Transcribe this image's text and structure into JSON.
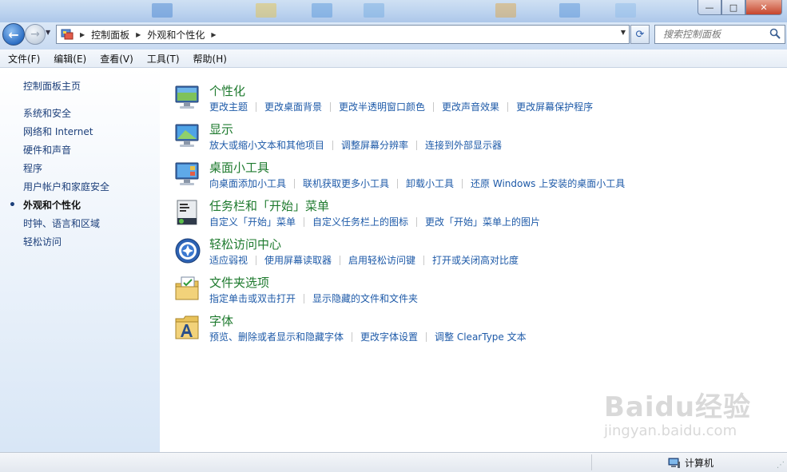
{
  "window": {
    "controls": {
      "minimize": "—",
      "maximize": "□",
      "close": "✕"
    }
  },
  "navigation": {
    "back_icon": "←",
    "forward_icon": "→",
    "breadcrumb": [
      "控制面板",
      "外观和个性化"
    ],
    "refresh_icon": "⟳",
    "search_placeholder": "搜索控制面板"
  },
  "menubar": [
    "文件(F)",
    "编辑(E)",
    "查看(V)",
    "工具(T)",
    "帮助(H)"
  ],
  "sidebar": {
    "home": "控制面板主页",
    "items": [
      "系统和安全",
      "网络和 Internet",
      "硬件和声音",
      "程序",
      "用户帐户和家庭安全",
      "外观和个性化",
      "时钟、语言和区域",
      "轻松访问"
    ],
    "current_index": 5
  },
  "categories": [
    {
      "title": "个性化",
      "icon": "personalization-monitor-icon",
      "links": [
        "更改主题",
        "更改桌面背景",
        "更改半透明窗口颜色",
        "更改声音效果",
        "更改屏幕保护程序"
      ]
    },
    {
      "title": "显示",
      "icon": "display-monitor-icon",
      "links": [
        "放大或缩小文本和其他项目",
        "调整屏幕分辨率",
        "连接到外部显示器"
      ]
    },
    {
      "title": "桌面小工具",
      "icon": "desktop-gadgets-icon",
      "links": [
        "向桌面添加小工具",
        "联机获取更多小工具",
        "卸载小工具",
        "还原 Windows 上安装的桌面小工具"
      ]
    },
    {
      "title": "任务栏和「开始」菜单",
      "icon": "taskbar-icon",
      "links": [
        "自定义「开始」菜单",
        "自定义任务栏上的图标",
        "更改「开始」菜单上的图片"
      ]
    },
    {
      "title": "轻松访问中心",
      "icon": "ease-of-access-icon",
      "links": [
        "适应弱视",
        "使用屏幕读取器",
        "启用轻松访问键",
        "打开或关闭高对比度"
      ]
    },
    {
      "title": "文件夹选项",
      "icon": "folder-options-icon",
      "links": [
        "指定单击或双击打开",
        "显示隐藏的文件和文件夹"
      ]
    },
    {
      "title": "字体",
      "icon": "fonts-folder-icon",
      "links": [
        "预览、删除或者显示和隐藏字体",
        "更改字体设置",
        "调整 ClearType 文本"
      ]
    }
  ],
  "statusbar": {
    "computer_label": "计算机"
  },
  "watermark": {
    "main": "Baidu经验",
    "sub": "jingyan.baidu.com"
  },
  "colors": {
    "category_title": "#1e7a2e",
    "link": "#1e5aa8",
    "nav_text": "#1c3f7a"
  }
}
